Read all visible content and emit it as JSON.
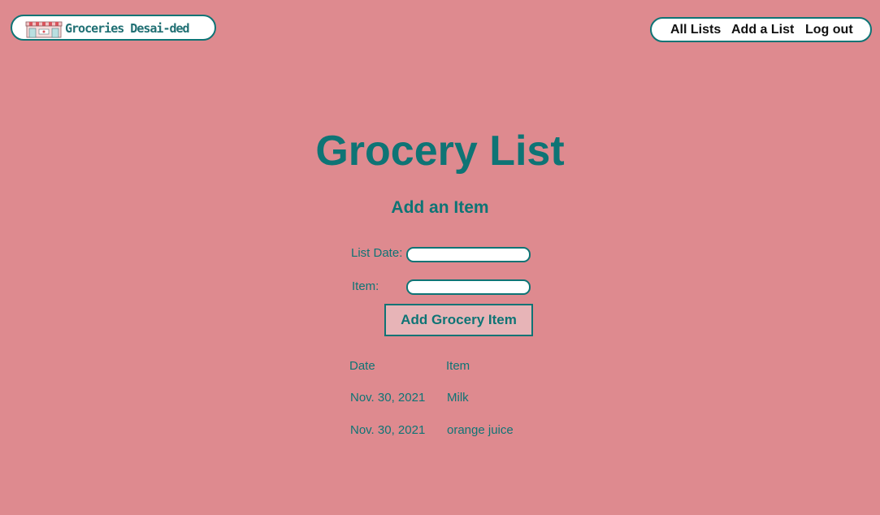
{
  "logo": {
    "text": "Groceries Desai-ded",
    "icon": "grocery-store-icon"
  },
  "nav": {
    "all_lists": "All Lists",
    "add_list": "Add a List",
    "log_out": "Log out"
  },
  "page": {
    "title": "Grocery List",
    "subtitle": "Add an Item"
  },
  "form": {
    "list_date_label": "List Date:",
    "list_date_value": "",
    "item_label": "Item:",
    "item_value": "",
    "submit_label": "Add Grocery Item"
  },
  "table": {
    "headers": [
      "Date",
      "Item"
    ],
    "rows": [
      {
        "date": "Nov. 30, 2021",
        "item": "Milk"
      },
      {
        "date": "Nov. 30, 2021",
        "item": "orange juice"
      }
    ]
  },
  "colors": {
    "background": "#de8a8f",
    "accent": "#0e7475",
    "button_bg": "#e7b4b7"
  }
}
